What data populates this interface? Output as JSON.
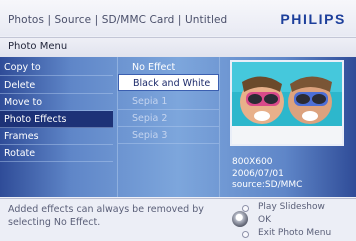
{
  "header": {
    "breadcrumb": "Photos | Source | SD/MMC Card | Untitled",
    "brand": "PHILIPS"
  },
  "menu_title": "Photo Menu",
  "photo_menu": {
    "items": [
      "Copy to",
      "Delete",
      "Move to",
      "Photo Effects",
      "Frames",
      "Rotate"
    ],
    "selected": "Photo Effects"
  },
  "effects": {
    "items": [
      "No Effect",
      "Black and White",
      "Sepia 1",
      "Sepia 2",
      "Sepia 3"
    ],
    "selected": "Black and White"
  },
  "photo_info": {
    "resolution": "800X600",
    "date": "2006/07/01",
    "source": "source:SD/MMC"
  },
  "footer": {
    "hint": "Added effects can always be removed by selecting No Effect.",
    "nav": {
      "play_slideshow": "Play Slideshow",
      "ok": "OK",
      "exit": "Exit Photo Menu"
    }
  },
  "colors": {
    "brand": "#1d3f9b",
    "panel_gradient": [
      "#2f4c98",
      "#7da6dc"
    ],
    "selected_item": "#1d3277"
  }
}
